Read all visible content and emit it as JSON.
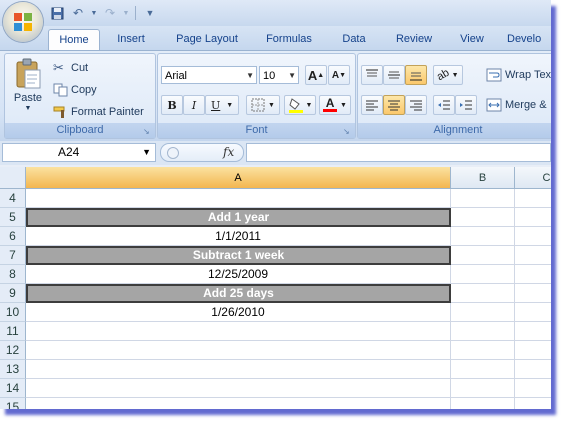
{
  "quick_access": {
    "icons": [
      "save-icon",
      "undo-icon",
      "redo-icon",
      "customize-icon"
    ]
  },
  "tabs": [
    "Home",
    "Insert",
    "Page Layout",
    "Formulas",
    "Data",
    "Review",
    "View",
    "Develo"
  ],
  "active_tab": "Home",
  "clipboard": {
    "paste_label": "Paste",
    "cut_label": "Cut",
    "copy_label": "Copy",
    "format_painter_label": "Format Painter",
    "group_label": "Clipboard"
  },
  "font": {
    "font_name": "Arial",
    "font_size": "10",
    "bold": "B",
    "italic": "I",
    "underline": "U",
    "grow": "A",
    "shrink": "A",
    "font_color_letter": "A",
    "group_label": "Font"
  },
  "alignment": {
    "wrap_text_label": "Wrap Tex",
    "merge_label": "Merge &",
    "group_label": "Alignment"
  },
  "formula_bar": {
    "name_box": "A24",
    "fx_label": "fx",
    "formula": ""
  },
  "columns": [
    "A",
    "B",
    "C"
  ],
  "selected_column": "A",
  "rows": [
    {
      "num": "4",
      "a": "",
      "header": false
    },
    {
      "num": "5",
      "a": "Add 1 year",
      "header": true
    },
    {
      "num": "6",
      "a": "1/1/2011",
      "header": false
    },
    {
      "num": "7",
      "a": "Subtract 1 week",
      "header": true
    },
    {
      "num": "8",
      "a": "12/25/2009",
      "header": false
    },
    {
      "num": "9",
      "a": "Add 25 days",
      "header": true
    },
    {
      "num": "10",
      "a": "1/26/2010",
      "header": false
    },
    {
      "num": "11",
      "a": "",
      "header": false
    },
    {
      "num": "12",
      "a": "",
      "header": false
    },
    {
      "num": "13",
      "a": "",
      "header": false
    },
    {
      "num": "14",
      "a": "",
      "header": false
    },
    {
      "num": "15",
      "a": "",
      "header": false
    }
  ],
  "colors": {
    "header_cell_bg": "#a5a5a5",
    "selected_col_header": "#f3b650",
    "ribbon_text": "#15428b"
  }
}
